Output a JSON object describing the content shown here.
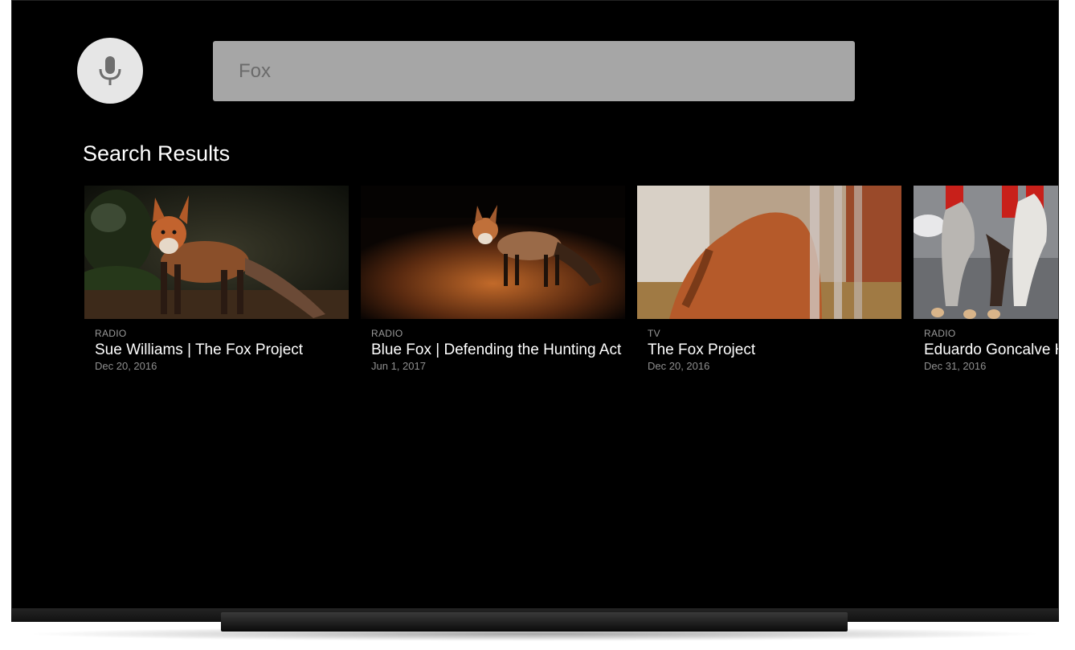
{
  "search": {
    "query": "Fox"
  },
  "results": {
    "heading": "Search Results",
    "items": [
      {
        "category": "RADIO",
        "title": "Sue Williams | The Fox Project",
        "date": "Dec 20, 2016",
        "thumbnail_icon": "fox-in-garden-image"
      },
      {
        "category": "RADIO",
        "title": "Blue Fox | Defending the Hunting Act",
        "date": "Jun 1, 2017",
        "thumbnail_icon": "fox-in-sunlight-image"
      },
      {
        "category": "TV",
        "title": "The Fox Project",
        "date": "Dec 20, 2016",
        "thumbnail_icon": "blurred-fox-image"
      },
      {
        "category": "RADIO",
        "title": "Eduardo Goncalve Hunts",
        "date": "Dec 31, 2016",
        "thumbnail_icon": "horse-hunt-image"
      }
    ]
  },
  "colors": {
    "screen_bg": "#000000",
    "search_box_bg": "#a6a6a6",
    "mic_button_bg": "#e6e6e6"
  }
}
